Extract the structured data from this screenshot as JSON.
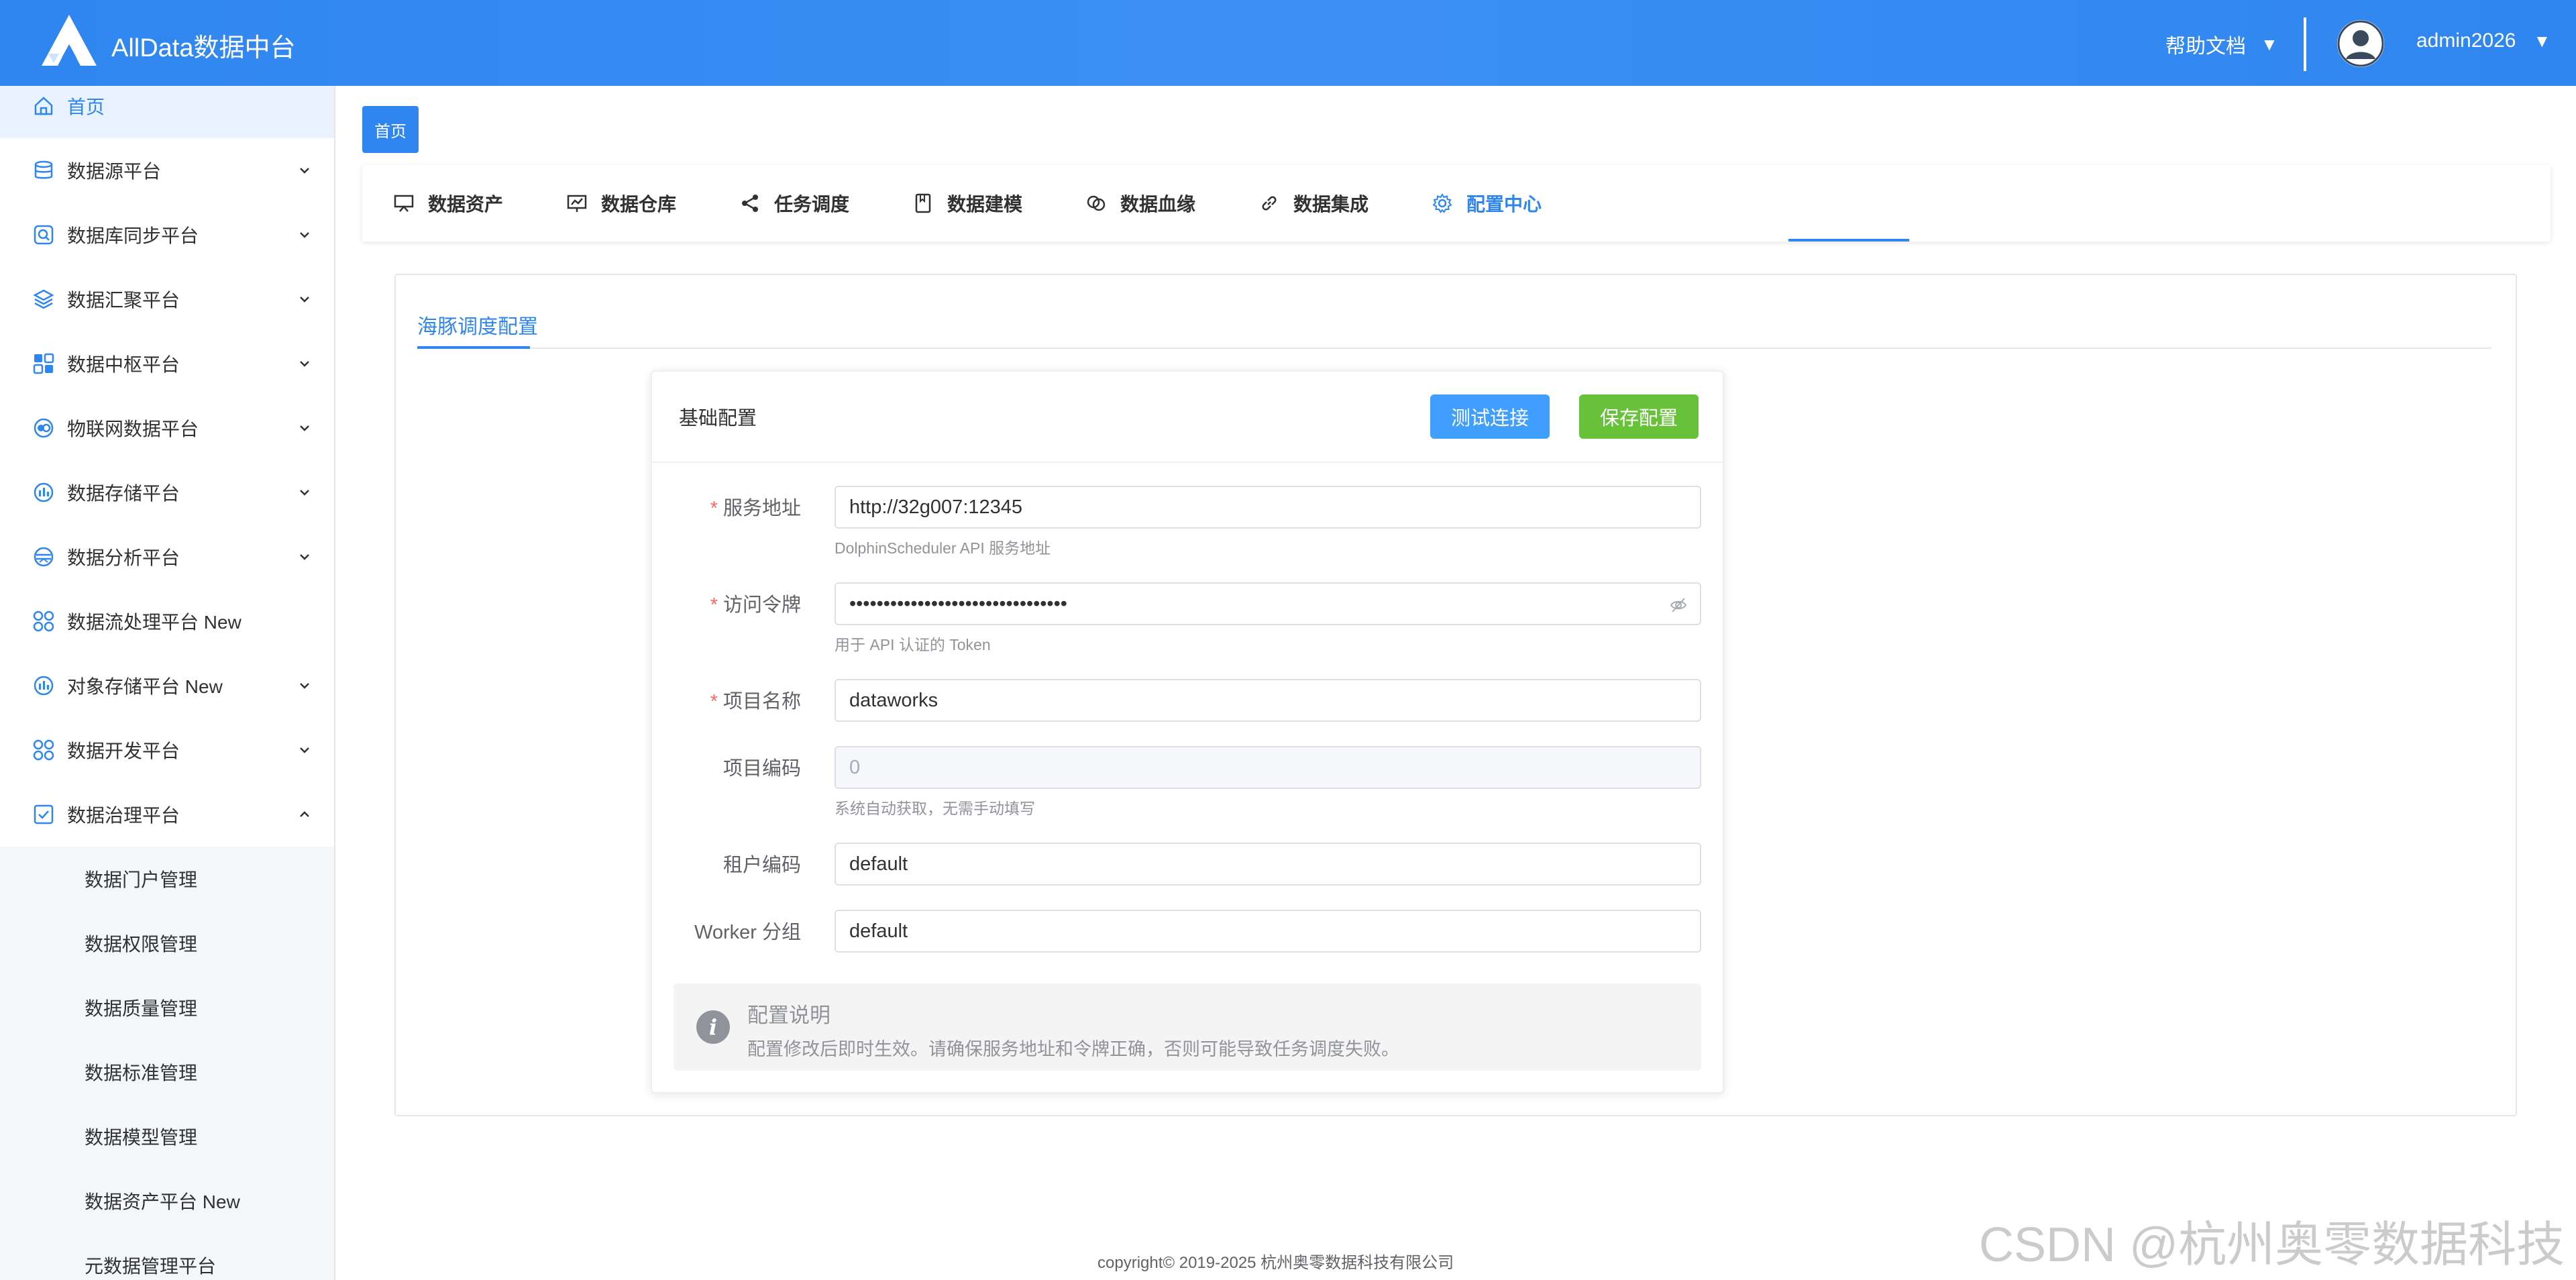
{
  "header": {
    "app_title": "AllData数据中台",
    "help_label": "帮助文档",
    "help_caret": "▼",
    "username": "admin2026",
    "user_caret": "▼",
    "background_color": "#2f86f0"
  },
  "sidebar": {
    "items": [
      {
        "label": "首页",
        "icon": "home-icon",
        "active": true
      },
      {
        "label": "数据源平台",
        "icon": "database-icon",
        "expandable": true
      },
      {
        "label": "数据库同步平台",
        "icon": "search-shield-icon",
        "expandable": true
      },
      {
        "label": "数据汇聚平台",
        "icon": "layers-icon",
        "expandable": true
      },
      {
        "label": "数据中枢平台",
        "icon": "grid-icon",
        "expandable": true
      },
      {
        "label": "物联网数据平台",
        "icon": "iot-icon",
        "expandable": true
      },
      {
        "label": "数据存储平台",
        "icon": "storage-icon",
        "expandable": true
      },
      {
        "label": "数据分析平台",
        "icon": "analysis-icon",
        "expandable": true
      },
      {
        "label": "数据流处理平台 New",
        "icon": "flow-icon",
        "expandable": false
      },
      {
        "label": "对象存储平台 New",
        "icon": "object-storage-icon",
        "expandable": true
      },
      {
        "label": "数据开发平台",
        "icon": "develop-icon",
        "expandable": true
      },
      {
        "label": "数据治理平台",
        "icon": "governance-icon",
        "expandable": true,
        "expanded": true
      }
    ],
    "sub_items": [
      "数据门户管理",
      "数据权限管理",
      "数据质量管理",
      "数据标准管理",
      "数据模型管理",
      "数据资产平台 New",
      "元数据管理平台"
    ]
  },
  "breadcrumb": {
    "home_tag": "首页"
  },
  "module_tabs": [
    {
      "label": "数据资产",
      "icon": "monitor-icon"
    },
    {
      "label": "数据仓库",
      "icon": "chart-board-icon"
    },
    {
      "label": "任务调度",
      "icon": "share-icon"
    },
    {
      "label": "数据建模",
      "icon": "notebook-icon"
    },
    {
      "label": "数据血缘",
      "icon": "link-circles-icon"
    },
    {
      "label": "数据集成",
      "icon": "chain-link-icon"
    },
    {
      "label": "配置中心",
      "icon": "gear-icon",
      "active": true
    }
  ],
  "inner_tab": {
    "label": "海豚调度配置"
  },
  "card": {
    "title": "基础配置",
    "test_button": "测试连接",
    "save_button": "保存配置",
    "fields": {
      "service_url": {
        "label": "服务地址",
        "required": true,
        "value": "http://32g007:12345",
        "help": "DolphinScheduler API 服务地址"
      },
      "access_token": {
        "label": "访问令牌",
        "required": true,
        "value": "••••••••••••••••••••••••••••••••",
        "help": "用于 API 认证的 Token"
      },
      "project_name": {
        "label": "项目名称",
        "required": true,
        "value": "dataworks"
      },
      "project_code": {
        "label": "项目编码",
        "required": false,
        "value": "0",
        "disabled": true,
        "help": "系统自动获取，无需手动填写"
      },
      "tenant_code": {
        "label": "租户编码",
        "required": false,
        "value": "default"
      },
      "worker_group": {
        "label": "Worker 分组",
        "required": false,
        "value": "default"
      }
    },
    "required_mark": "*",
    "notice": {
      "title": "配置说明",
      "body": "配置修改后即时生效。请确保服务地址和令牌正确，否则可能导致任务调度失败。",
      "icon_glyph": "i"
    }
  },
  "footer": {
    "copyright": "copyright© 2019-2025 杭州奥零数据科技有限公司"
  },
  "watermark": "CSDN @杭州奥零数据科技",
  "colors": {
    "primary": "#2f86f0",
    "button_test": "#409eff",
    "button_save": "#67c23a",
    "required": "#f56c6c"
  }
}
